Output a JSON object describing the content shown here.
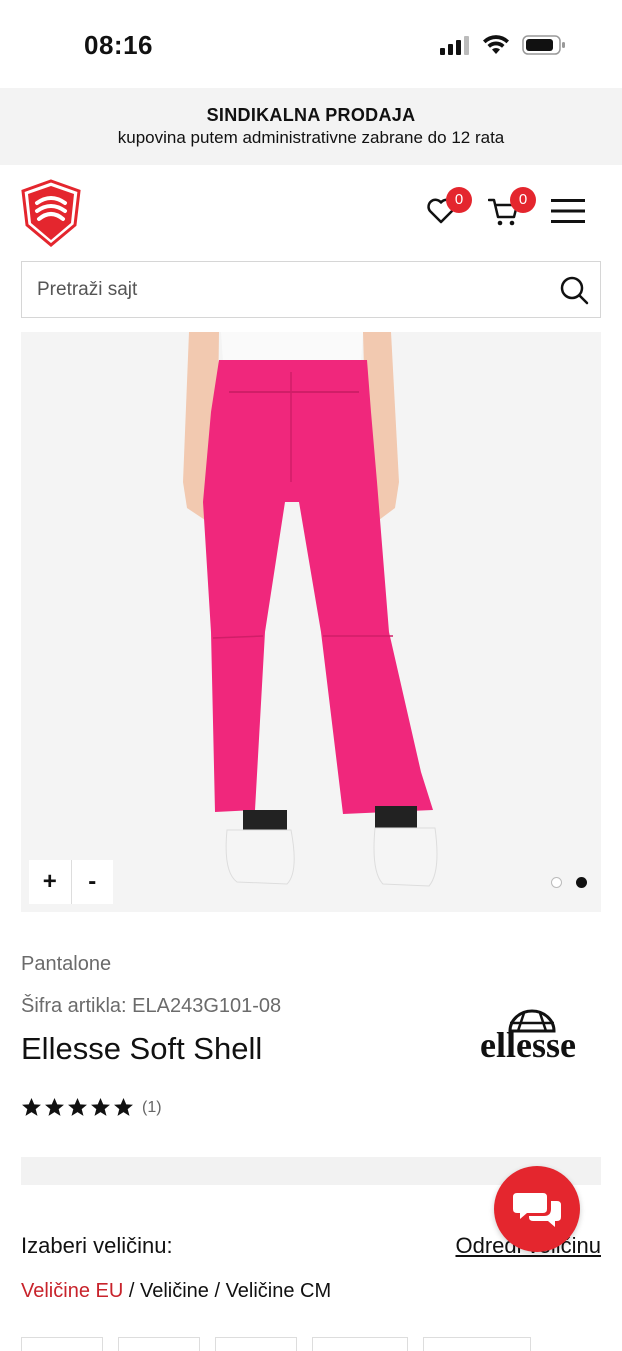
{
  "status_bar": {
    "time": "08:16"
  },
  "promo": {
    "title": "SINDIKALNA PRODAJA",
    "subtitle": "kupovina putem administrativne zabrane do 12 rata"
  },
  "header": {
    "wishlist_count": "0",
    "cart_count": "0",
    "accent_color": "#e4262e"
  },
  "search": {
    "placeholder": "Pretraži sajt"
  },
  "gallery": {
    "zoom_in": "+",
    "zoom_out": "-",
    "total_images": 2,
    "active_image": 2
  },
  "product": {
    "category": "Pantalone",
    "sku": "Šifra artikla: ELA243G101-08",
    "title": "Ellesse Soft Shell",
    "brand": "ellesse",
    "rating": 5,
    "rating_count": "(1)"
  },
  "sizes": {
    "label": "Izaberi veličinu:",
    "guide_link": "Odredi veličinu",
    "systems": [
      "Veličine EU",
      "Veličine",
      "Veličine CM"
    ],
    "separator": " / ",
    "active_system": "Veličine EU"
  }
}
